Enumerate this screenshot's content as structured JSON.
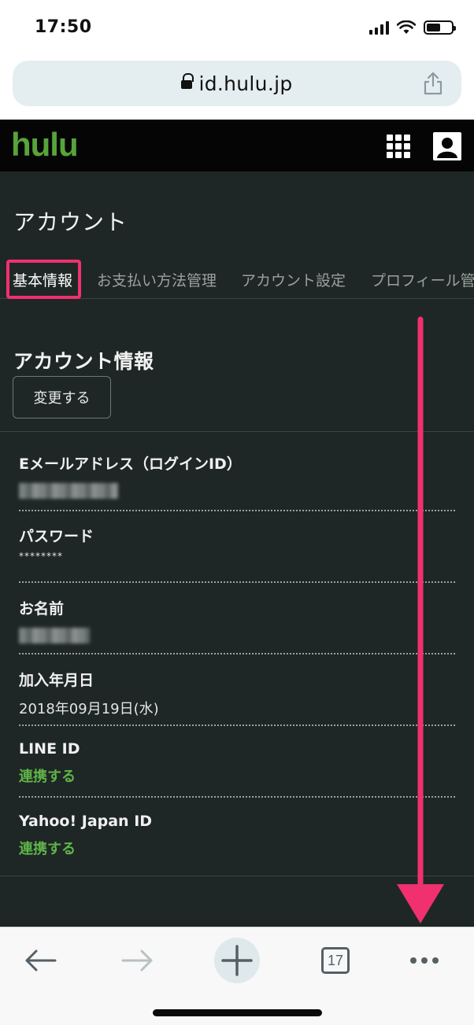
{
  "status_bar": {
    "time": "17:50",
    "icons": [
      "signal-icon",
      "wifi-icon",
      "battery-icon"
    ],
    "battery_level": 0.55
  },
  "browser": {
    "url": "id.hulu.jp",
    "tab_count": "17"
  },
  "header": {
    "logo": "hulu",
    "brand_color": "#57a43a",
    "icons": [
      "apps-grid-icon",
      "user-icon"
    ]
  },
  "page": {
    "title": "アカウント",
    "tabs": [
      {
        "label": "基本情報",
        "active": true
      },
      {
        "label": "お支払い方法管理",
        "active": false
      },
      {
        "label": "アカウント設定",
        "active": false
      },
      {
        "label": "プロフィール管",
        "active": false
      }
    ],
    "section_title": "アカウント情報",
    "change_button": "変更する",
    "fields": [
      {
        "label": "Eメールアドレス（ログインID）",
        "value": ""
      },
      {
        "label": "パスワード",
        "value": "********"
      },
      {
        "label": "お名前",
        "value": ""
      },
      {
        "label": "加入年月日",
        "value": "2018年09月19日(水)"
      },
      {
        "label": "LINE ID",
        "value": "連携する"
      },
      {
        "label": "Yahoo! Japan ID",
        "value": "連携する"
      }
    ]
  },
  "colors": {
    "annotation": "#f0306f",
    "link": "#5fb24a",
    "background": "#1e2725"
  }
}
